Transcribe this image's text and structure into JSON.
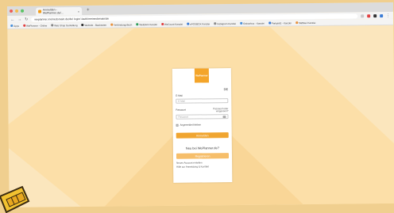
{
  "browser": {
    "tab_title": "Anmelden - WePlanner.de/...",
    "close_tab": "×",
    "new_tab": "+",
    "address": "weplanner.meinedomain.de/de/ login/ /auth/meinedomain/de",
    "bookmarks": [
      {
        "label": "Apps",
        "color": "#4a90d9"
      },
      {
        "label": "WePlanner - Online",
        "color": "#e04040"
      },
      {
        "label": "Web Shop Gestaltung",
        "color": "#888888"
      },
      {
        "label": "Website - Baukasten",
        "color": "#333333"
      },
      {
        "label": "Verbindungsbuch",
        "color": "#e8903a"
      },
      {
        "label": "Weitblick Kanzlei",
        "color": "#2f9e5a"
      },
      {
        "label": "WeCount Kanzlei",
        "color": "#e04040"
      },
      {
        "label": "ePOSBOX Kanzlei",
        "color": "#3a7bd5"
      },
      {
        "label": "Instagram Kanzlei",
        "color": "#8a8a8a"
      },
      {
        "label": "Ordnerbox - Kanzlei",
        "color": "#4a90d9"
      },
      {
        "label": "Parkplatz - Kanzlei",
        "color": "#3a7bd5"
      },
      {
        "label": "Staffelei Kanzlei",
        "color": "#e8903a"
      }
    ]
  },
  "login": {
    "logo_text": "WePlanner",
    "language": "DE",
    "email_label": "E-Mail",
    "email_placeholder": "E-Mail",
    "password_label": "Passwort",
    "forgot_line1": "Passwort oder",
    "forgot_line2": "vergessen?",
    "password_placeholder": "Passwort",
    "remember": "Angemeldet bleiben",
    "login_button": "Anmelden",
    "signup_question": "Neu bei WePlanner.de?",
    "signup_button": "Registrieren",
    "link1": "Neuen Account erstellen",
    "link2": "Hilfe zur Anmeldung & Kontakt"
  },
  "colors": {
    "accent": "#f0a530",
    "background": "#fcdfa8"
  }
}
